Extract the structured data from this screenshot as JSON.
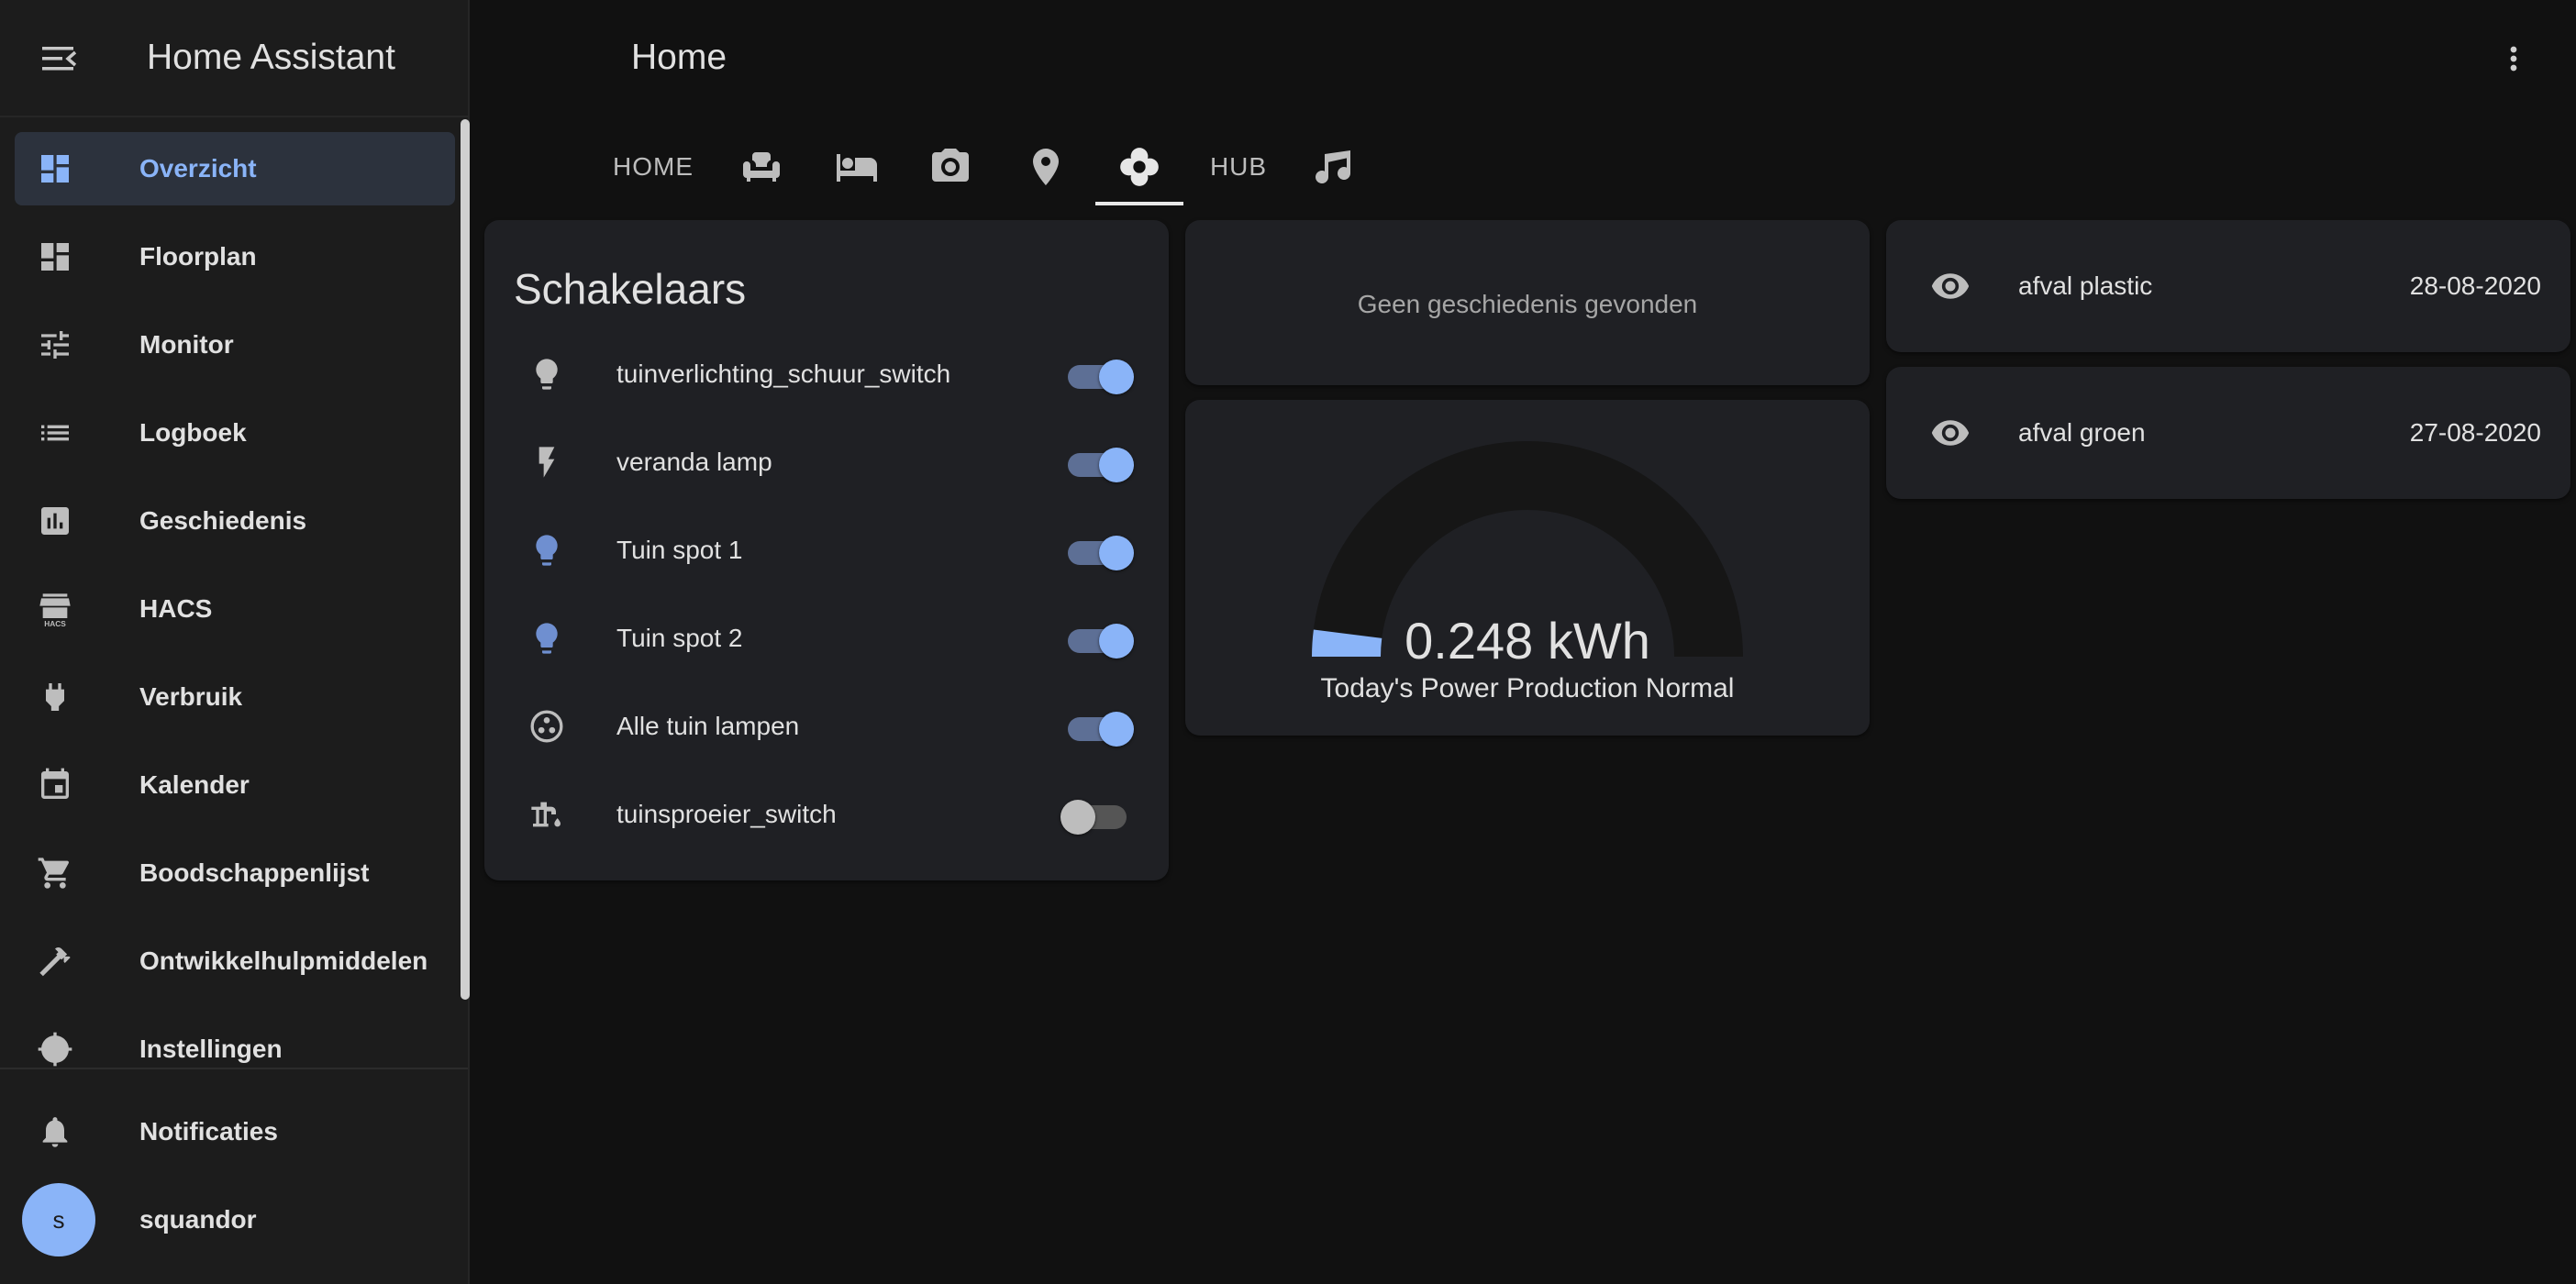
{
  "app": {
    "title": "Home Assistant"
  },
  "header": {
    "page_title": "Home"
  },
  "tabs": [
    {
      "label": "HOME",
      "icon": null
    },
    {
      "label": null,
      "icon": "sofa-icon"
    },
    {
      "label": null,
      "icon": "bed-icon"
    },
    {
      "label": null,
      "icon": "camera-icon"
    },
    {
      "label": null,
      "icon": "map-marker-icon"
    },
    {
      "label": null,
      "icon": "flower-icon",
      "active": true
    },
    {
      "label": "HUB",
      "icon": null
    },
    {
      "label": null,
      "icon": "music-icon"
    }
  ],
  "sidebar": {
    "items": [
      {
        "label": "Overzicht",
        "icon": "dashboard-icon",
        "active": true
      },
      {
        "label": "Floorplan",
        "icon": "dashboard-icon"
      },
      {
        "label": "Monitor",
        "icon": "tune-icon"
      },
      {
        "label": "Logboek",
        "icon": "list-icon"
      },
      {
        "label": "Geschiedenis",
        "icon": "chart-box-icon"
      },
      {
        "label": "HACS",
        "icon": "hacs-store-icon"
      },
      {
        "label": "Verbruik",
        "icon": "power-plug-icon"
      },
      {
        "label": "Kalender",
        "icon": "calendar-icon"
      },
      {
        "label": "Boodschappenlijst",
        "icon": "cart-icon"
      },
      {
        "label": "Ontwikkelhulpmiddelen",
        "icon": "hammer-icon"
      },
      {
        "label": "Instellingen",
        "icon": "cog-icon"
      }
    ],
    "notifications_label": "Notificaties",
    "user": {
      "name": "squandor",
      "initial": "s"
    }
  },
  "switches_card": {
    "title": "Schakelaars",
    "rows": [
      {
        "name": "tuinverlichting_schuur_switch",
        "icon": "lightbulb-icon",
        "on": true
      },
      {
        "name": "veranda lamp",
        "icon": "flash-icon",
        "on": true
      },
      {
        "name": "Tuin spot 1",
        "icon": "lightbulb-icon",
        "on": true
      },
      {
        "name": "Tuin spot 2",
        "icon": "lightbulb-icon",
        "on": true
      },
      {
        "name": "Alle tuin lampen",
        "icon": "group-icon",
        "on": true
      },
      {
        "name": "tuinsproeier_switch",
        "icon": "water-pump-icon",
        "on": false
      }
    ]
  },
  "history_card": {
    "message": "Geen geschiedenis gevonden"
  },
  "gauge_card": {
    "value": "0.248 kWh",
    "name": "Today's Power Production Normal",
    "fraction": 0.04
  },
  "entities": [
    {
      "name": "afval plastic",
      "state": "28-08-2020",
      "icon": "eye-icon"
    },
    {
      "name": "afval groen",
      "state": "27-08-2020",
      "icon": "eye-icon"
    }
  ],
  "colors": {
    "accent": "#8ab4f8",
    "background": "#111111",
    "card": "#1f2024",
    "sidebar": "#1c1c1c"
  }
}
